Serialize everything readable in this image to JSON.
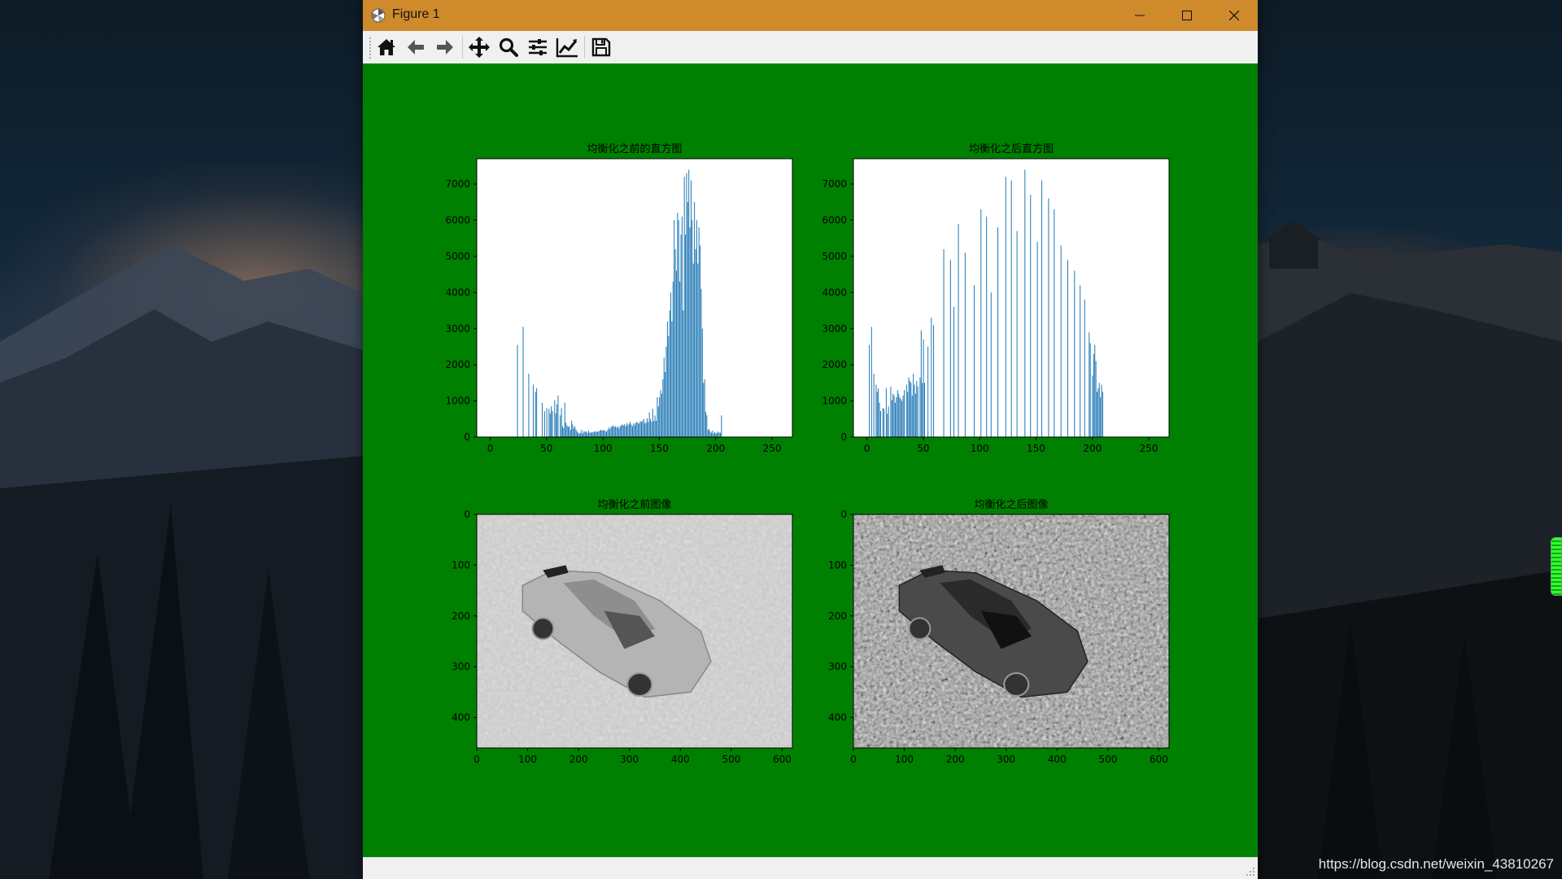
{
  "window": {
    "title": "Figure 1"
  },
  "toolbar": {
    "tools": [
      "home-icon",
      "back-arrow-icon",
      "forward-arrow-icon",
      "pan-move-icon",
      "zoom-magnifier-icon",
      "subplots-sliders-icon",
      "edit-axis-lines-icon",
      "save-floppy-icon"
    ]
  },
  "figure": {
    "background_color": "#008000",
    "bar_color": "#1f77b4"
  },
  "watermark": "https://blog.csdn.net/weixin_43810267",
  "chart_data": [
    {
      "type": "bar",
      "title": "均衡化之前的直方图",
      "xlim": [
        -12,
        268
      ],
      "ylim": [
        0,
        7700
      ],
      "xticks": [
        0,
        50,
        100,
        150,
        200,
        250
      ],
      "yticks": [
        0,
        1000,
        2000,
        3000,
        4000,
        5000,
        6000,
        7000
      ],
      "x": [
        0,
        1,
        2,
        3,
        4,
        5,
        6,
        7,
        8,
        9,
        10,
        11,
        12,
        13,
        14,
        15,
        16,
        17,
        18,
        19,
        20,
        21,
        22,
        23,
        24,
        25,
        26,
        27,
        28,
        29,
        30,
        31,
        32,
        33,
        34,
        35,
        36,
        37,
        38,
        39,
        40,
        41,
        42,
        43,
        44,
        45,
        46,
        47,
        48,
        49,
        50,
        51,
        52,
        53,
        54,
        55,
        56,
        57,
        58,
        59,
        60,
        61,
        62,
        63,
        64,
        65,
        66,
        67,
        68,
        69,
        70,
        71,
        72,
        73,
        74,
        75,
        76,
        77,
        78,
        79,
        80,
        81,
        82,
        83,
        84,
        85,
        86,
        87,
        88,
        89,
        90,
        91,
        92,
        93,
        94,
        95,
        96,
        97,
        98,
        99,
        100,
        101,
        102,
        103,
        104,
        105,
        106,
        107,
        108,
        109,
        110,
        111,
        112,
        113,
        114,
        115,
        116,
        117,
        118,
        119,
        120,
        121,
        122,
        123,
        124,
        125,
        126,
        127,
        128,
        129,
        130,
        131,
        132,
        133,
        134,
        135,
        136,
        137,
        138,
        139,
        140,
        141,
        142,
        143,
        144,
        145,
        146,
        147,
        148,
        149,
        150,
        151,
        152,
        153,
        154,
        155,
        156,
        157,
        158,
        159,
        160,
        161,
        162,
        163,
        164,
        165,
        166,
        167,
        168,
        169,
        170,
        171,
        172,
        173,
        174,
        175,
        176,
        177,
        178,
        179,
        180,
        181,
        182,
        183,
        184,
        185,
        186,
        187,
        188,
        189,
        190,
        191,
        192,
        193,
        194,
        195,
        196,
        197,
        198,
        199,
        200,
        201,
        202,
        203,
        204,
        205,
        206,
        207,
        208,
        209,
        210,
        211,
        212,
        213,
        214,
        215,
        216,
        217,
        218,
        219,
        220,
        221,
        222,
        223,
        224,
        225,
        226,
        227,
        228,
        229,
        230,
        231,
        232,
        233,
        234,
        235,
        236,
        237,
        238,
        239,
        240,
        241,
        242,
        243,
        244,
        245,
        246,
        247,
        248,
        249,
        250,
        251,
        252,
        253,
        254,
        255
      ],
      "values": [
        0,
        0,
        0,
        0,
        0,
        0,
        0,
        0,
        0,
        0,
        0,
        0,
        0,
        0,
        0,
        0,
        0,
        0,
        0,
        0,
        0,
        0,
        0,
        0,
        2550,
        0,
        0,
        0,
        0,
        3050,
        0,
        0,
        0,
        0,
        1750,
        0,
        0,
        0,
        1450,
        0,
        1250,
        1350,
        0,
        0,
        0,
        0,
        950,
        0,
        720,
        0,
        800,
        0,
        780,
        650,
        850,
        720,
        0,
        1020,
        650,
        900,
        1150,
        0,
        600,
        800,
        300,
        250,
        950,
        400,
        320,
        280,
        300,
        200,
        450,
        350,
        250,
        300,
        200,
        150,
        120,
        100,
        120,
        200,
        100,
        160,
        150,
        150,
        120,
        180,
        120,
        140,
        120,
        140,
        150,
        150,
        160,
        140,
        160,
        180,
        200,
        180,
        200,
        180,
        170,
        150,
        200,
        260,
        220,
        280,
        300,
        320,
        280,
        300,
        260,
        300,
        240,
        300,
        320,
        350,
        320,
        360,
        300,
        380,
        330,
        370,
        420,
        350,
        300,
        380,
        340,
        400,
        420,
        380,
        380,
        440,
        420,
        450,
        500,
        380,
        400,
        520,
        420,
        680,
        500,
        420,
        780,
        450,
        600,
        450,
        1100,
        850,
        1100,
        1300,
        1200,
        1600,
        2200,
        1800,
        2500,
        3200,
        2800,
        3500,
        4000,
        3200,
        4300,
        6000,
        5200,
        4600,
        6200,
        6000,
        4300,
        5600,
        6100,
        3500,
        7200,
        5600,
        7300,
        6500,
        7400,
        5800,
        7100,
        6000,
        4800,
        6500,
        5200,
        6000,
        4800,
        5800,
        5300,
        4100,
        3000,
        1500,
        1600,
        700,
        600,
        200,
        220,
        150,
        120,
        180,
        100,
        140,
        100,
        120,
        150,
        120,
        120,
        600,
        0,
        0,
        0,
        0,
        0,
        0,
        0,
        0,
        0,
        0,
        0,
        0,
        0,
        0,
        0,
        0,
        0,
        0,
        0,
        0,
        0,
        0,
        0,
        0,
        0,
        0,
        0,
        0,
        0,
        0,
        0,
        0,
        0,
        0,
        0,
        0,
        0,
        0,
        0,
        0,
        0,
        0,
        0,
        0,
        0,
        0,
        0,
        0,
        0,
        0
      ]
    },
    {
      "type": "bar",
      "title": "均衡化之后直方图",
      "xlim": [
        -12,
        268
      ],
      "ylim": [
        0,
        7700
      ],
      "xticks": [
        0,
        50,
        100,
        150,
        200,
        250
      ],
      "yticks": [
        0,
        1000,
        2000,
        3000,
        4000,
        5000,
        6000,
        7000
      ],
      "x": [
        0,
        1,
        2,
        3,
        4,
        5,
        6,
        7,
        8,
        9,
        10,
        11,
        12,
        13,
        14,
        15,
        16,
        17,
        18,
        19,
        20,
        21,
        22,
        23,
        24,
        25,
        26,
        27,
        28,
        29,
        30,
        31,
        32,
        33,
        34,
        35,
        36,
        37,
        38,
        39,
        40,
        41,
        42,
        43,
        44,
        45,
        46,
        47,
        48,
        49,
        50,
        51,
        52,
        53,
        54,
        55,
        56,
        57,
        58,
        59,
        60,
        61,
        62,
        63,
        64,
        65,
        66,
        67,
        68,
        69,
        70,
        71,
        72,
        73,
        74,
        75,
        76,
        77,
        78,
        79,
        80,
        81,
        82,
        83,
        84,
        85,
        86,
        87,
        88,
        89,
        90,
        91,
        92,
        93,
        94,
        95,
        96,
        97,
        98,
        99,
        100,
        101,
        102,
        103,
        104,
        105,
        106,
        107,
        108,
        109,
        110,
        111,
        112,
        113,
        114,
        115,
        116,
        117,
        118,
        119,
        120,
        121,
        122,
        123,
        124,
        125,
        126,
        127,
        128,
        129,
        130,
        131,
        132,
        133,
        134,
        135,
        136,
        137,
        138,
        139,
        140,
        141,
        142,
        143,
        144,
        145,
        146,
        147,
        148,
        149,
        150,
        151,
        152,
        153,
        154,
        155,
        156,
        157,
        158,
        159,
        160,
        161,
        162,
        163,
        164,
        165,
        166,
        167,
        168,
        169,
        170,
        171,
        172,
        173,
        174,
        175,
        176,
        177,
        178,
        179,
        180,
        181,
        182,
        183,
        184,
        185,
        186,
        187,
        188,
        189,
        190,
        191,
        192,
        193,
        194,
        195,
        196,
        197,
        198,
        199,
        200,
        201,
        202,
        203,
        204,
        205,
        206,
        207,
        208,
        209,
        210,
        211,
        212,
        213,
        214,
        215,
        216,
        217,
        218,
        219,
        220,
        221,
        222,
        223,
        224,
        225,
        226,
        227,
        228,
        229,
        230,
        231,
        232,
        233,
        234,
        235,
        236,
        237,
        238,
        239,
        240,
        241,
        242,
        243,
        244,
        245,
        246,
        247,
        248,
        249,
        250,
        251,
        252,
        253,
        254,
        255
      ],
      "values": [
        0,
        0,
        2550,
        0,
        3050,
        0,
        1750,
        0,
        1450,
        1250,
        1350,
        950,
        720,
        0,
        800,
        780,
        0,
        1350,
        650,
        850,
        0,
        1400,
        1020,
        1200,
        1150,
        950,
        1100,
        1300,
        1200,
        1100,
        1050,
        1000,
        1150,
        1300,
        0,
        1450,
        1250,
        1650,
        1550,
        1500,
        1150,
        1750,
        1450,
        1200,
        1550,
        1400,
        0,
        1650,
        2950,
        1500,
        2700,
        1500,
        0,
        0,
        2500,
        0,
        0,
        3300,
        0,
        3100,
        0,
        0,
        0,
        0,
        0,
        0,
        0,
        0,
        5200,
        0,
        0,
        0,
        0,
        0,
        4900,
        0,
        0,
        3600,
        0,
        0,
        0,
        5900,
        0,
        0,
        0,
        0,
        0,
        5100,
        0,
        0,
        0,
        0,
        0,
        0,
        0,
        4200,
        0,
        0,
        0,
        0,
        0,
        6300,
        0,
        0,
        0,
        0,
        6100,
        0,
        0,
        0,
        4000,
        0,
        0,
        0,
        0,
        0,
        5800,
        0,
        0,
        0,
        0,
        0,
        0,
        7200,
        0,
        0,
        0,
        0,
        7100,
        0,
        0,
        0,
        0,
        5700,
        0,
        0,
        0,
        0,
        0,
        0,
        7400,
        0,
        0,
        0,
        0,
        6700,
        0,
        0,
        0,
        0,
        0,
        5400,
        0,
        0,
        0,
        7100,
        0,
        0,
        0,
        0,
        0,
        6600,
        0,
        0,
        0,
        0,
        6300,
        0,
        0,
        0,
        0,
        0,
        5300,
        0,
        0,
        0,
        0,
        0,
        4900,
        0,
        0,
        0,
        0,
        0,
        4600,
        0,
        0,
        0,
        0,
        4200,
        0,
        0,
        0,
        3800,
        0,
        0,
        0,
        2900,
        2600,
        0,
        1700,
        2300,
        2550,
        2100,
        1250,
        1350,
        1500,
        1100,
        1450,
        1250,
        0,
        0,
        0,
        0,
        0,
        0,
        0,
        0,
        0,
        0,
        0,
        0,
        0,
        0,
        0,
        0,
        0,
        0,
        0,
        0,
        0,
        0,
        0,
        0,
        0,
        0,
        0,
        0,
        0,
        0,
        0,
        0,
        0,
        0,
        0,
        0,
        0,
        0,
        0,
        0,
        0,
        0,
        0,
        0,
        0,
        0,
        0,
        0,
        0,
        0,
        0,
        0,
        0,
        0,
        0,
        0,
        0,
        0,
        0
      ]
    },
    {
      "type": "image",
      "title": "均衡化之前图像",
      "xlim": [
        0,
        620
      ],
      "ylim": [
        460,
        0
      ],
      "xticks": [
        0,
        100,
        200,
        300,
        400,
        500,
        600
      ],
      "yticks": [
        0,
        100,
        200,
        300,
        400
      ],
      "background_tone": "#c8c8c8",
      "car_tone": "#b4b4b4"
    },
    {
      "type": "image",
      "title": "均衡化之后图像",
      "xlim": [
        0,
        620
      ],
      "ylim": [
        460,
        0
      ],
      "xticks": [
        0,
        100,
        200,
        300,
        400,
        500,
        600
      ],
      "yticks": [
        0,
        100,
        200,
        300,
        400
      ],
      "background_tone": "#9a9a9a",
      "car_tone": "#4a4a4a"
    }
  ]
}
